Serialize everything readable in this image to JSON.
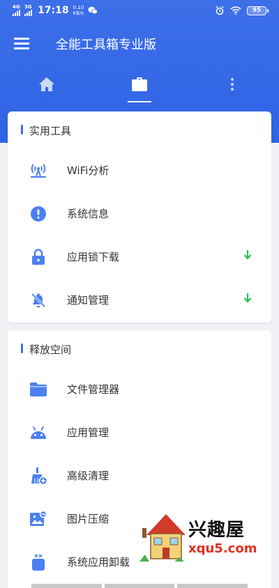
{
  "status_bar": {
    "sim1": "4G",
    "sim2": "3G",
    "time": "17:18",
    "speed_value": "0.10",
    "speed_unit": "KB/s",
    "battery": "95"
  },
  "app_bar": {
    "title": "全能工具箱专业版"
  },
  "tabs": [
    {
      "icon": "home-icon"
    },
    {
      "icon": "briefcase-icon",
      "selected": true
    },
    {
      "icon": "more-vertical-icon"
    }
  ],
  "sections": [
    {
      "title": "实用工具",
      "items": [
        {
          "label": "WiFi分析",
          "icon": "wifi-tower-icon"
        },
        {
          "label": "系统信息",
          "icon": "info-exclamation-icon"
        },
        {
          "label": "应用锁下载",
          "icon": "lock-icon",
          "download": true
        },
        {
          "label": "通知管理",
          "icon": "bell-off-icon",
          "download": true
        }
      ]
    },
    {
      "title": "释放空间",
      "items": [
        {
          "label": "文件管理器",
          "icon": "folder-icon"
        },
        {
          "label": "应用管理",
          "icon": "android-icon"
        },
        {
          "label": "高级清理",
          "icon": "broom-icon"
        },
        {
          "label": "图片压缩",
          "icon": "image-icon"
        },
        {
          "label": "系统应用卸载",
          "icon": "uninstall-icon"
        }
      ]
    }
  ],
  "watermark": {
    "title": "兴趣屋",
    "url": "xqu5.com"
  },
  "colors": {
    "primary": "#2f63e6",
    "icon_blue": "#4a80f0",
    "download_green": "#2ebd59"
  }
}
